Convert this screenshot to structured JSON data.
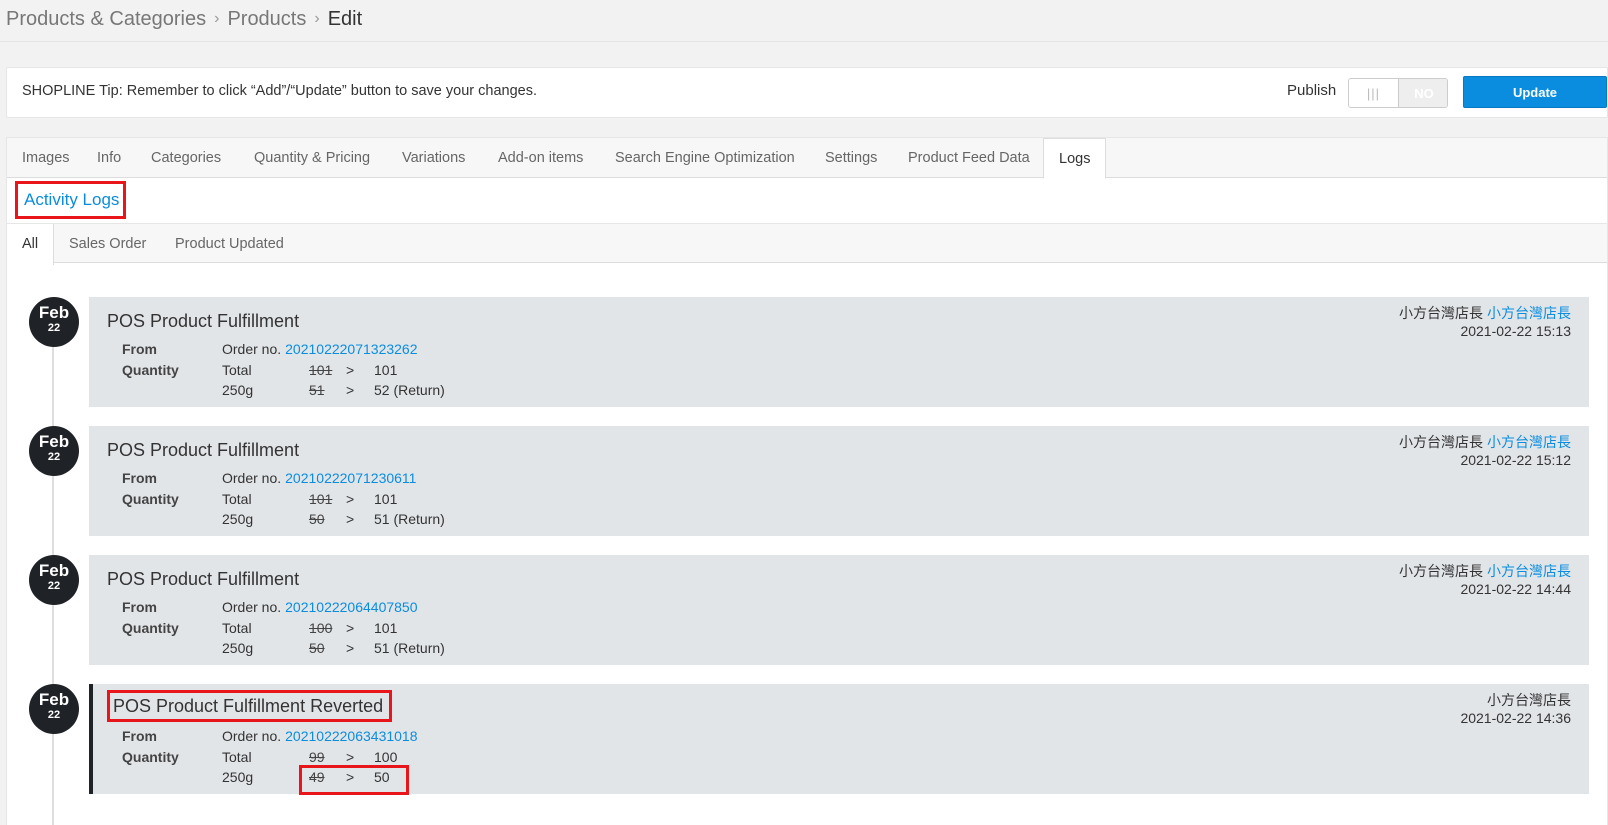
{
  "breadcrumb": {
    "items": [
      "Products & Categories",
      "Products"
    ],
    "current": "Edit"
  },
  "tipbar": {
    "tip": "SHOPLINE Tip: Remember to click “Add”/“Update” button to save your changes.",
    "publish_label": "Publish",
    "toggle_state": "NO",
    "toggle_handle": "|||",
    "update_label": "Update"
  },
  "tabs": [
    "Images",
    "Info",
    "Categories",
    "Quantity & Pricing",
    "Variations",
    "Add-on items",
    "Search Engine Optimization",
    "Settings",
    "Product Feed Data",
    "Logs"
  ],
  "active_tab": "Logs",
  "section_title": "Activity Logs",
  "subtabs": [
    "All",
    "Sales Order",
    "Product Updated"
  ],
  "labels": {
    "from": "From",
    "quantity": "Quantity",
    "order_prefix": "Order no.",
    "total": "Total",
    "arrow": ">"
  },
  "logs": [
    {
      "month": "Feb",
      "day": "22",
      "title": "POS Product Fulfillment",
      "user": "小方台灣店長",
      "user_link": "小方台灣店長",
      "time": "2021-02-22 15:13",
      "order_no": "20210222071323262",
      "total_old": "101",
      "total_new": "101",
      "variant": "250g",
      "variant_old": "51",
      "variant_new": "52 (Return)"
    },
    {
      "month": "Feb",
      "day": "22",
      "title": "POS Product Fulfillment",
      "user": "小方台灣店長",
      "user_link": "小方台灣店長",
      "time": "2021-02-22 15:12",
      "order_no": "20210222071230611",
      "total_old": "101",
      "total_new": "101",
      "variant": "250g",
      "variant_old": "50",
      "variant_new": "51 (Return)"
    },
    {
      "month": "Feb",
      "day": "22",
      "title": "POS Product Fulfillment",
      "user": "小方台灣店長",
      "user_link": "小方台灣店長",
      "time": "2021-02-22 14:44",
      "order_no": "20210222064407850",
      "total_old": "100",
      "total_new": "101",
      "variant": "250g",
      "variant_old": "50",
      "variant_new": "51 (Return)"
    },
    {
      "month": "Feb",
      "day": "22",
      "title": "POS Product Fulfillment Reverted",
      "user": "小方台灣店長",
      "time": "2021-02-22 14:36",
      "order_no": "20210222063431018",
      "total_old": "99",
      "total_new": "100",
      "variant": "250g",
      "variant_old": "49",
      "variant_new": "50"
    }
  ],
  "colors": {
    "accent": "#0a8ddf",
    "highlight": "#e8161a",
    "card_bg": "#e2e5e8",
    "bubble": "#1f2226"
  }
}
